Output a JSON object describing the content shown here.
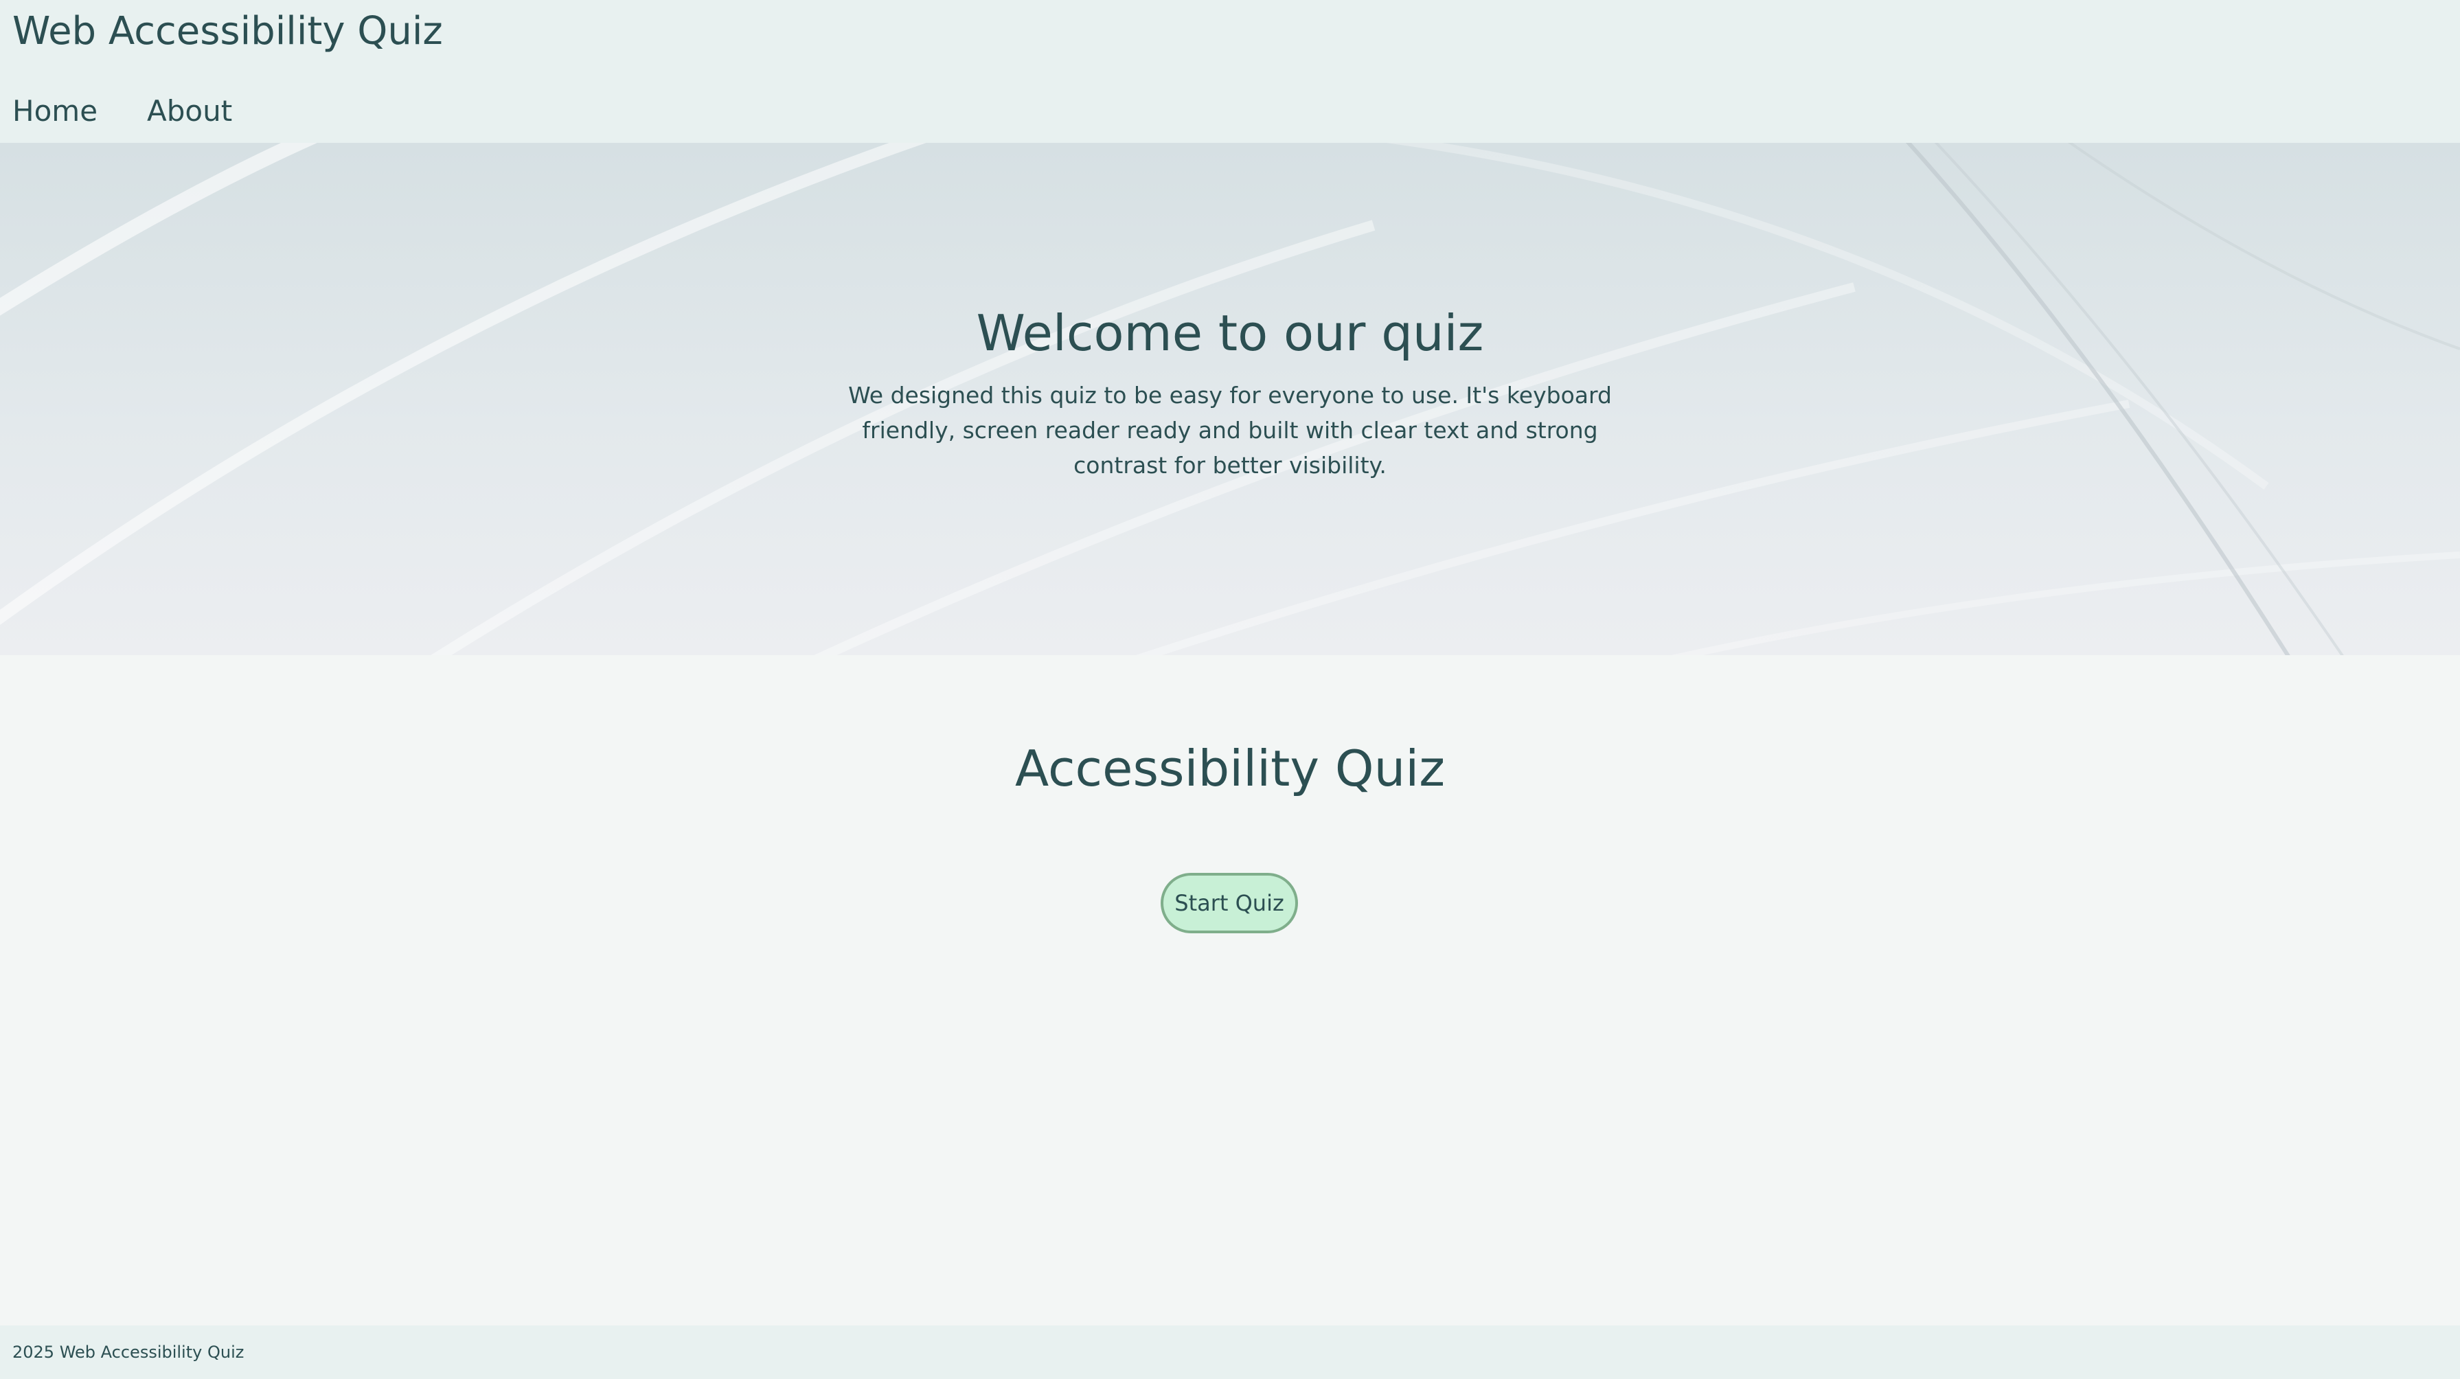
{
  "header": {
    "site_title": "Web Accessibility Quiz",
    "nav": {
      "home_label": "Home",
      "about_label": "About"
    }
  },
  "hero": {
    "title": "Welcome to our quiz",
    "description": "We designed this quiz to be easy for everyone to use. It's keyboard friendly, screen reader ready and built with clear text and strong contrast for better visibility."
  },
  "main": {
    "quiz_title": "Accessibility Quiz",
    "start_button_label": "Start Quiz"
  },
  "footer": {
    "text": "2025 Web Accessibility Quiz"
  },
  "colors": {
    "text": "#2c4f52",
    "header_bg": "#e8f1f0",
    "page_bg": "#f3f6f5",
    "button_bg": "#c8f0d6",
    "button_border": "#7fae8b"
  }
}
